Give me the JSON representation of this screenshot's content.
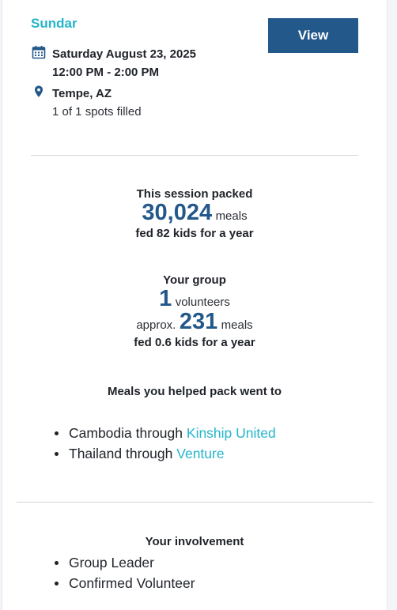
{
  "session": {
    "org_name": "Sundar",
    "view_label": "View",
    "date": "Saturday August 23, 2025",
    "time": "12:00 PM - 2:00 PM",
    "location": "Tempe, AZ",
    "spots": "1 of 1 spots filled"
  },
  "session_impact": {
    "label": "This session packed",
    "meals_count": "30,024",
    "meals_unit": "meals",
    "fed_text": "fed 82 kids for a year"
  },
  "group_impact": {
    "label": "Your group",
    "volunteers_count": "1",
    "volunteers_unit": "volunteers",
    "approx_prefix": "approx.",
    "meals_count": "231",
    "meals_unit": "meals",
    "fed_text": "fed 0.6 kids for a year"
  },
  "destinations": {
    "heading": "Meals you helped pack went to",
    "items": [
      {
        "country": "Cambodia",
        "through": "through",
        "partner": "Kinship United"
      },
      {
        "country": "Thailand",
        "through": "through",
        "partner": "Venture"
      }
    ]
  },
  "involvement": {
    "heading": "Your involvement",
    "items": [
      "Group Leader",
      "Confirmed Volunteer"
    ]
  },
  "colors": {
    "accent": "#25b5cb",
    "primary": "#23588a"
  },
  "icons": {
    "date": "calendar-icon",
    "location": "map-pin-icon"
  }
}
